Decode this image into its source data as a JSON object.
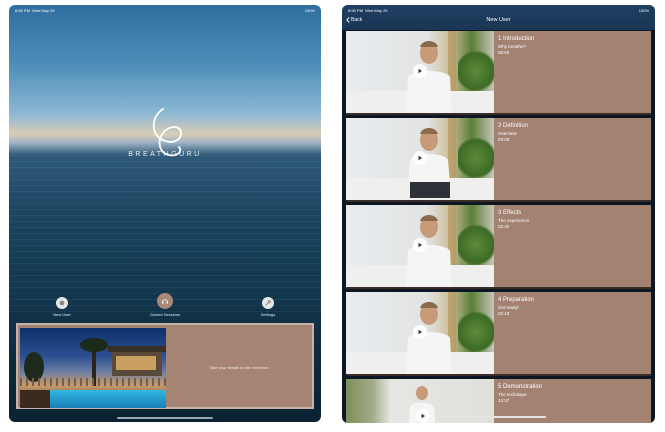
{
  "left_screen": {
    "status": {
      "time": "8:55 PM",
      "date": "Wed May 29",
      "battery": "100%"
    },
    "brand_name": "BREATHGURU",
    "nav": [
      {
        "label": "New User",
        "icon": "user-circle-icon"
      },
      {
        "label": "Guided Sessions",
        "icon": "headphones-icon"
      },
      {
        "label": "Settings",
        "icon": "wrench-icon"
      }
    ],
    "promo_text": "Take your breath to the next level ›"
  },
  "right_screen": {
    "status": {
      "time": "8:55 PM",
      "date": "Wed May 29",
      "battery": "100%"
    },
    "back_label": "Back",
    "title": "New User",
    "lessons": [
      {
        "title": "1 Introduction",
        "subtitle": "Why breathe?",
        "duration": "00:50"
      },
      {
        "title": "2 Definition",
        "subtitle": "Overview",
        "duration": "03:08"
      },
      {
        "title": "3 Effects",
        "subtitle": "The experience",
        "duration": "02:40"
      },
      {
        "title": "4 Preparation",
        "subtitle": "Get ready!",
        "duration": "02:10"
      },
      {
        "title": "5 Demonstration",
        "subtitle": "The technique",
        "duration": "14:37"
      }
    ]
  },
  "colors": {
    "card_bg": "#a38272",
    "nav_bar": "#1f3f63"
  }
}
